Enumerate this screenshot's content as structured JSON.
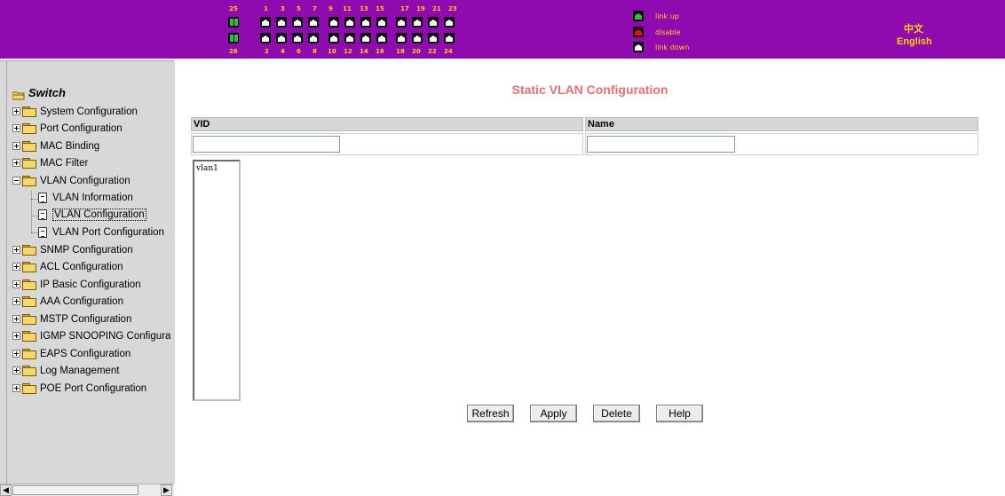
{
  "ports": {
    "top_labels": [
      "25",
      "1",
      "3",
      "5",
      "7",
      "9",
      "11",
      "13",
      "15",
      "17",
      "19",
      "21",
      "23"
    ],
    "bottom_labels": [
      "26",
      "2",
      "4",
      "6",
      "8",
      "10",
      "12",
      "14",
      "16",
      "18",
      "20",
      "22",
      "24"
    ]
  },
  "legend": {
    "link_up": "link up",
    "disable": "disable",
    "link_down": "link down",
    "colors": {
      "link_up": "#2cc43a",
      "disable": "#e01010",
      "link_down": "#ffffff"
    }
  },
  "language": {
    "chinese": "中文",
    "english": "English"
  },
  "sidebar": {
    "root": "Switch",
    "items": [
      {
        "label": "System Configuration"
      },
      {
        "label": "Port Configuration"
      },
      {
        "label": "MAC Binding"
      },
      {
        "label": "MAC Filter"
      },
      {
        "label": "VLAN Configuration"
      },
      {
        "label": "VLAN Information"
      },
      {
        "label": "VLAN Configuration"
      },
      {
        "label": "VLAN Port Configuration"
      },
      {
        "label": "SNMP Configuration"
      },
      {
        "label": "ACL Configuration"
      },
      {
        "label": "IP Basic Configuration"
      },
      {
        "label": "AAA Configuration"
      },
      {
        "label": "MSTP Configuration"
      },
      {
        "label": "IGMP SNOOPING Configura"
      },
      {
        "label": "EAPS Configuration"
      },
      {
        "label": "Log Management"
      },
      {
        "label": "POE Port Configuration"
      }
    ]
  },
  "main": {
    "title": "Static VLAN Configuration",
    "columns": {
      "vid": "VID",
      "name": "Name"
    },
    "vid_value": "",
    "name_value": "",
    "vlan_list": [
      "vlan1"
    ],
    "buttons": {
      "refresh": "Refresh",
      "apply": "Apply",
      "delete": "Delete",
      "help": "Help"
    }
  },
  "colors": {
    "header_bg": "#8f0bb0",
    "header_text": "#ffd400",
    "title": "#ef6f6f"
  }
}
